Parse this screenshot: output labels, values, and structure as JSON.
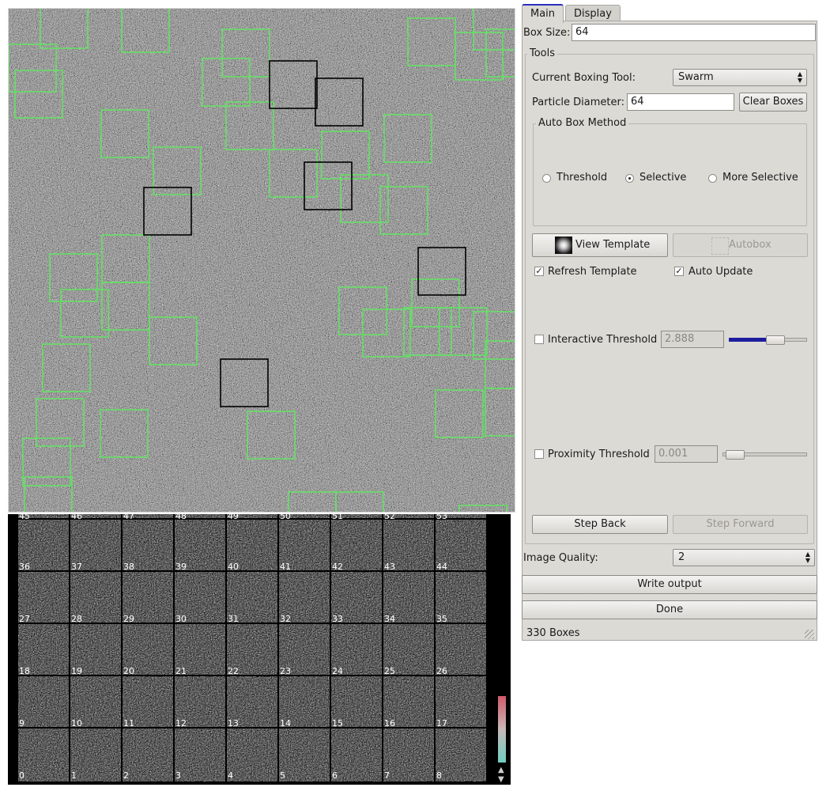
{
  "tabs": [
    {
      "label": "Main",
      "active": true
    },
    {
      "label": "Display",
      "active": false
    }
  ],
  "main": {
    "box_size_label": "Box Size:",
    "box_size_value": "64",
    "tools_group_title": "Tools",
    "boxing_tool_label": "Current Boxing Tool:",
    "boxing_tool_value": "Swarm",
    "particle_diameter_label": "Particle Diameter:",
    "particle_diameter_value": "64",
    "clear_boxes_label": "Clear Boxes",
    "auto_box_method_title": "Auto Box Method",
    "auto_box_methods": [
      {
        "label": "Threshold",
        "checked": false
      },
      {
        "label": "Selective",
        "checked": true
      },
      {
        "label": "More Selective",
        "checked": false
      }
    ],
    "view_template_label": "View Template",
    "autobox_label": "Autobox",
    "refresh_template_label": "Refresh Template",
    "refresh_template_checked": true,
    "auto_update_label": "Auto Update",
    "auto_update_checked": true,
    "interactive_threshold_label": "Interactive Threshold",
    "interactive_threshold_checked": false,
    "interactive_threshold_value": "2.888",
    "interactive_threshold_level": 0.62,
    "proximity_threshold_label": "Proximity Threshold",
    "proximity_threshold_checked": false,
    "proximity_threshold_value": "0.001",
    "proximity_threshold_level": 0.05,
    "step_back_label": "Step Back",
    "step_forward_label": "Step Forward",
    "image_quality_label": "Image Quality:",
    "image_quality_value": "2",
    "write_output_label": "Write output",
    "done_label": "Done",
    "status_text": "330 Boxes"
  },
  "particle_grid": {
    "top_row_labels": [
      "45",
      "46",
      "47",
      "48",
      "49",
      "50",
      "51",
      "52",
      "53"
    ],
    "row_labels": [
      [
        "36",
        "37",
        "38",
        "39",
        "40",
        "41",
        "42",
        "43",
        "44"
      ],
      [
        "27",
        "28",
        "29",
        "30",
        "31",
        "32",
        "33",
        "34",
        "35"
      ],
      [
        "18",
        "19",
        "20",
        "21",
        "22",
        "23",
        "24",
        "25",
        "26"
      ],
      [
        "9",
        "10",
        "11",
        "12",
        "13",
        "14",
        "15",
        "16",
        "17"
      ],
      [
        "0",
        "1",
        "2",
        "3",
        "4",
        "5",
        "6",
        "7",
        "8"
      ]
    ]
  },
  "colors": {
    "box_auto": "#66e066",
    "box_manual": "#000000",
    "panel_bg": "#dcdad5",
    "slider_fill": "#1d1d9e"
  }
}
